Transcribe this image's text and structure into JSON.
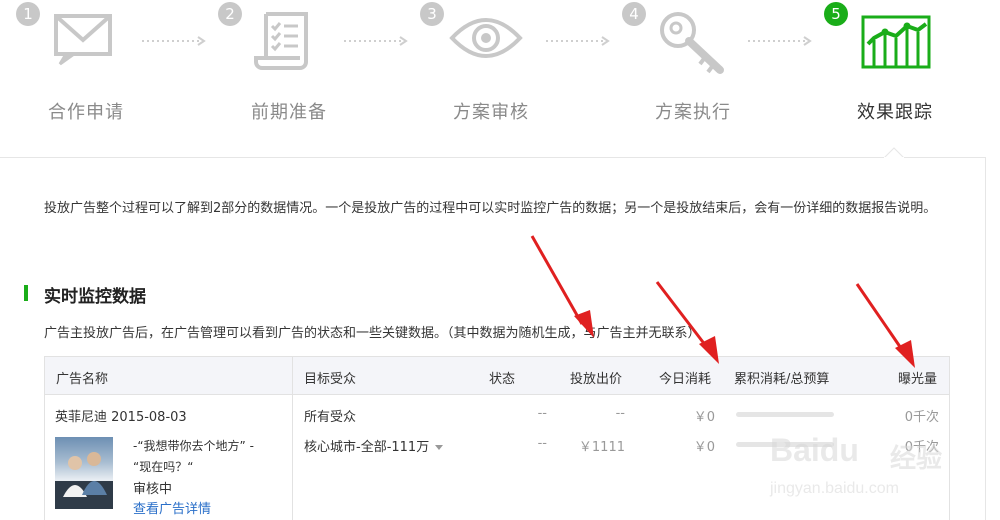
{
  "steps": [
    {
      "number": "1",
      "label": "合作申请",
      "icon": "envelope-icon"
    },
    {
      "number": "2",
      "label": "前期准备",
      "icon": "document-checklist-icon"
    },
    {
      "number": "3",
      "label": "方案审核",
      "icon": "eye-icon"
    },
    {
      "number": "4",
      "label": "方案执行",
      "icon": "key-icon"
    },
    {
      "number": "5",
      "label": "效果跟踪",
      "icon": "line-chart-icon",
      "active": true
    }
  ],
  "colors": {
    "accent": "#1aad19",
    "inactive_step": "#c8c8c8",
    "annotation": "#e02020",
    "link": "#2a6fc9"
  },
  "intro": "投放广告整个过程可以了解到2部分的数据情况。一个是投放广告的过程中可以实时监控广告的数据；另一个是投放结束后，会有一份详细的数据报告说明。",
  "section": {
    "title": "实时监控数据",
    "description": "广告主投放广告后，在广告管理可以看到广告的状态和一些关键数据。（其中数据为随机生成，与广告主并无联系）"
  },
  "table": {
    "headers": {
      "name": "广告名称",
      "audience": "目标受众",
      "status": "状态",
      "bid": "投放出价",
      "today": "今日消耗",
      "budget": "累积消耗/总预算",
      "exposure": "曝光量"
    },
    "ad": {
      "name": "英菲尼迪 2015-08-03",
      "copy_line1": "-“我想带你去个地方” -",
      "copy_line2": "“现在吗？“",
      "review_status": "审核中",
      "detail_link": "查看广告详情",
      "rows": [
        {
          "audience": "所有受众",
          "status": "--",
          "bid": "--",
          "today": "￥0",
          "budget_progress": 0,
          "exposure": "0千次"
        },
        {
          "audience": "核心城市-全部-111万",
          "status": "--",
          "bid": "￥1111",
          "today": "￥0",
          "budget_progress": 0,
          "exposure": "0千次"
        }
      ]
    }
  },
  "watermark": {
    "brand": "Baidu",
    "brand_cn": "经验",
    "url": "jingyan.baidu.com"
  }
}
